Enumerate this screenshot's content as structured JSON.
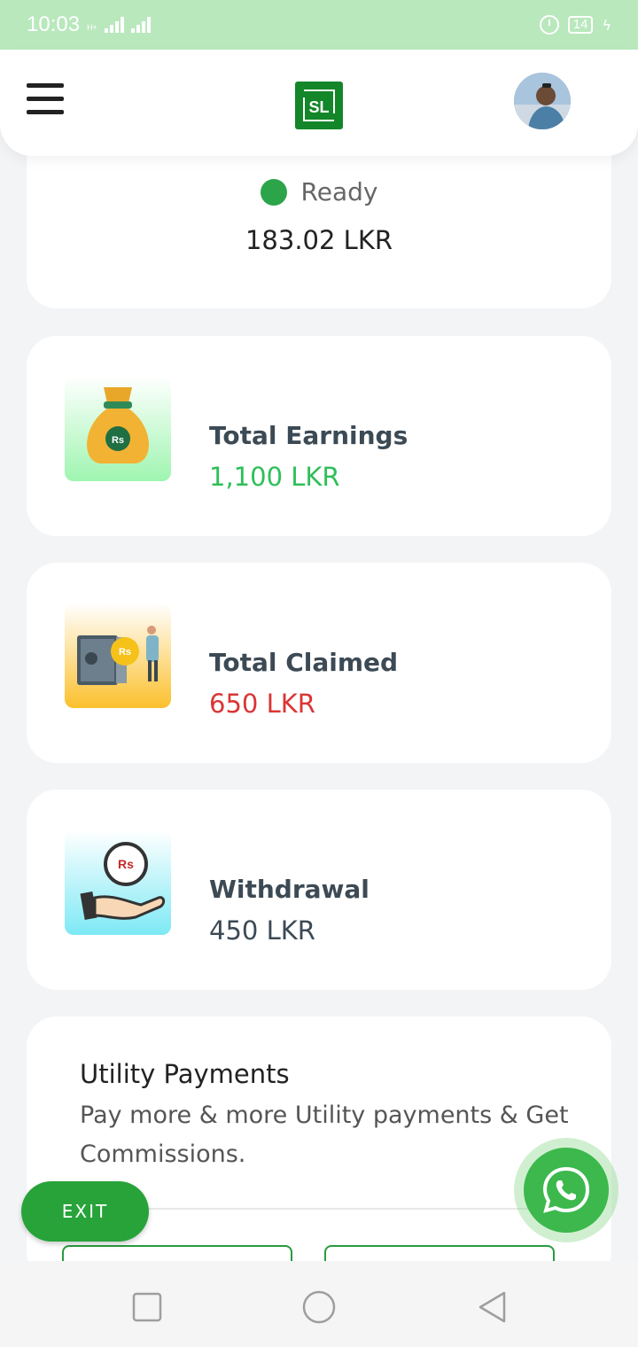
{
  "status_bar": {
    "time": "10:03",
    "network": "H+",
    "battery": "14"
  },
  "header": {
    "logo_text": "SL"
  },
  "wallet": {
    "status": "Ready",
    "balance": "183.02 LKR"
  },
  "stats": [
    {
      "title": "Total Earnings",
      "value": "1,100 LKR",
      "color": "#2fbf5a",
      "icon": "money-bag-icon",
      "icon_text": "Rs"
    },
    {
      "title": "Total Claimed",
      "value": "650 LKR",
      "color": "#d93535",
      "icon": "safe-icon",
      "icon_text": "Rs"
    },
    {
      "title": "Withdrawal",
      "value": "450 LKR",
      "color": "#3c4a55",
      "icon": "hand-coin-icon",
      "icon_text": "Rs"
    }
  ],
  "utility": {
    "title": "Utility Payments",
    "description": "Pay more & more Utility payments & Get Commissions."
  },
  "exit_label": "EXIT",
  "colors": {
    "accent": "#27a33a",
    "status_bar": "#b9e8bd"
  }
}
